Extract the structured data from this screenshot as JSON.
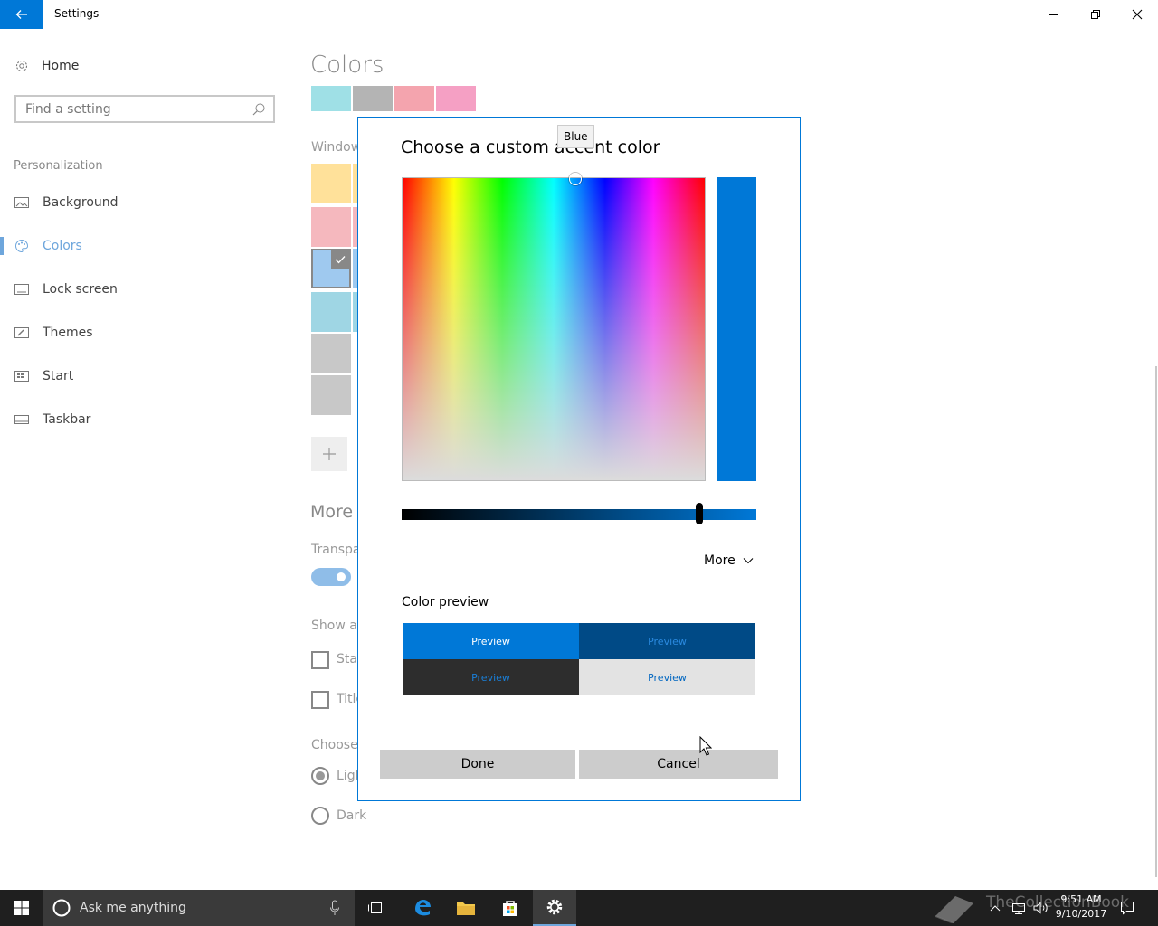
{
  "window": {
    "title": "Settings",
    "controls": [
      "minimize",
      "restore",
      "close"
    ]
  },
  "nav": {
    "home_label": "Home",
    "search_placeholder": "Find a setting",
    "section_label": "Personalization",
    "items": [
      {
        "label": "Background",
        "icon": "picture-icon",
        "active": false
      },
      {
        "label": "Colors",
        "icon": "palette-icon",
        "active": true
      },
      {
        "label": "Lock screen",
        "icon": "lock-screen-icon",
        "active": false
      },
      {
        "label": "Themes",
        "icon": "brush-icon",
        "active": false
      },
      {
        "label": "Start",
        "icon": "start-icon",
        "active": false
      },
      {
        "label": "Taskbar",
        "icon": "taskbar-icon",
        "active": false
      }
    ]
  },
  "main": {
    "title": "Colors",
    "recent_swatches": [
      "#9fe0e6",
      "#b4b4b4",
      "#f4a4ae",
      "#f5a0c4"
    ],
    "windows_colors_label": "Window",
    "grid_swatches": [
      {
        "color": "#ffe19a",
        "selected": false
      },
      {
        "color": "#f5b8be",
        "selected": false
      },
      {
        "color": "#9fc9ef",
        "selected": true
      },
      {
        "color": "#9fd6e4",
        "selected": false
      },
      {
        "color": "#c8c8c8",
        "selected": false
      },
      {
        "color": "#c8c8c8",
        "selected": false
      }
    ],
    "more_heading": "More",
    "transparency_label": "Transpa",
    "show_accent_label": "Show ac",
    "checkbox_start": "Star",
    "checkbox_title": "Title",
    "choose_mode_label": "Choose",
    "radio_light": "Ligh",
    "radio_dark": "Dark"
  },
  "dialog": {
    "title": "Choose a custom accent color",
    "tooltip": "Blue",
    "selected_color": "#0078d7",
    "value_level": 0.84,
    "more_label": "More",
    "preview_label": "Color preview",
    "preview_text": "Preview",
    "done_label": "Done",
    "cancel_label": "Cancel"
  },
  "taskbar": {
    "search_text": "Ask me anything",
    "watermark": "TheCollectionBook",
    "time": "9:51 AM",
    "date": "9/10/2017",
    "pinned": [
      "task-view-icon",
      "edge-icon",
      "file-explorer-icon",
      "store-icon",
      "settings-icon"
    ]
  }
}
